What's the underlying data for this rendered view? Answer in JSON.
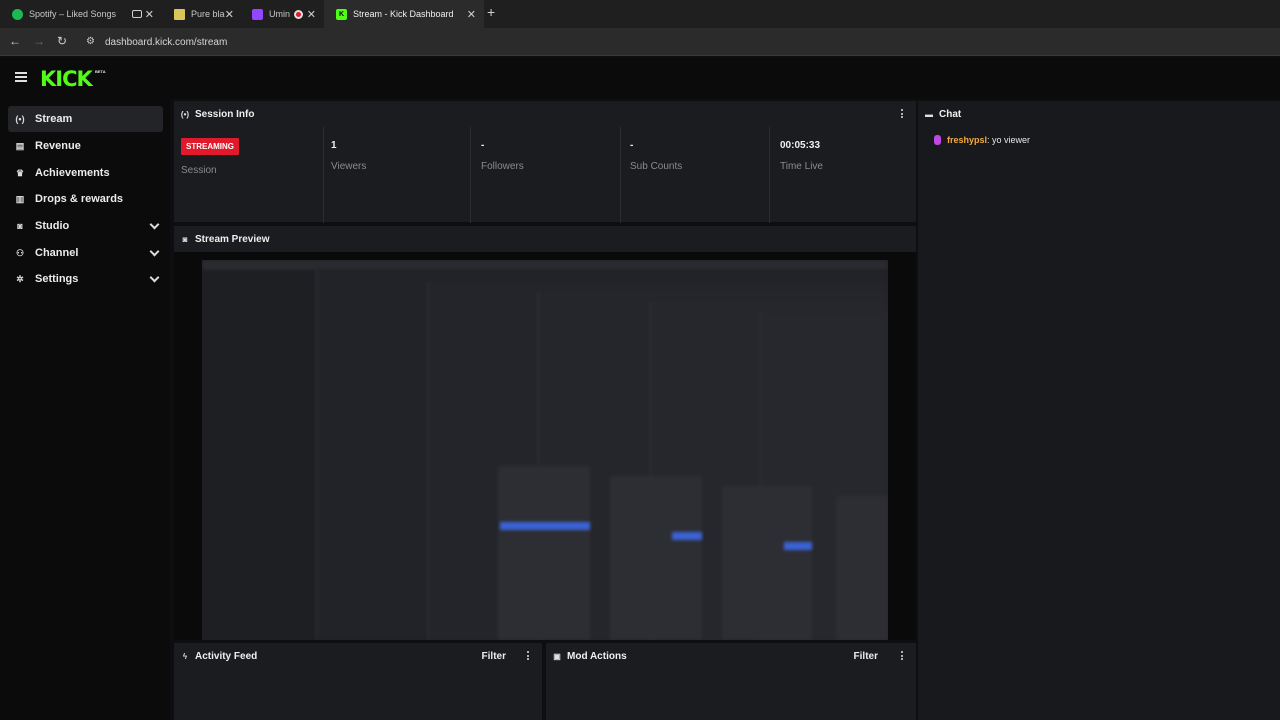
{
  "browser": {
    "tabs": [
      {
        "title": "Spotify – Liked Songs",
        "favicon": "spotify-icon",
        "color": "#1db954",
        "active": false
      },
      {
        "title": "",
        "favicon": "tab-media-icon",
        "color": "#cfcfcf",
        "active": false
      },
      {
        "title": "Pure black",
        "favicon": "pure-black-icon",
        "color": "#d8c65a",
        "active": false
      },
      {
        "title": "Umin",
        "favicon": "twitch-icon",
        "color": "#9146ff",
        "active": false
      },
      {
        "title": "Stream - Kick Dashboard",
        "favicon": "kick-icon",
        "color": "#53fc18",
        "active": true
      }
    ],
    "url": "dashboard.kick.com/stream"
  },
  "header": {
    "logo": "KICK",
    "beta": "BETA"
  },
  "sidebar": {
    "items": [
      {
        "label": "Stream",
        "icon": "broadcast-icon",
        "active": true,
        "expandable": false
      },
      {
        "label": "Revenue",
        "icon": "revenue-icon",
        "active": false,
        "expandable": false
      },
      {
        "label": "Achievements",
        "icon": "trophy-icon",
        "active": false,
        "expandable": false
      },
      {
        "label": "Drops & rewards",
        "icon": "gift-icon",
        "active": false,
        "expandable": false
      },
      {
        "label": "Studio",
        "icon": "studio-icon",
        "active": false,
        "expandable": true
      },
      {
        "label": "Channel",
        "icon": "channel-icon",
        "active": false,
        "expandable": true
      },
      {
        "label": "Settings",
        "icon": "gear-icon",
        "active": false,
        "expandable": true
      }
    ]
  },
  "session": {
    "title": "Session Info",
    "status_badge": "STREAMING",
    "status_label": "Session",
    "stats": [
      {
        "value": "1",
        "label": "Viewers"
      },
      {
        "value": "-",
        "label": "Followers"
      },
      {
        "value": "-",
        "label": "Sub Counts"
      },
      {
        "value": "00:05:33",
        "label": "Time Live"
      }
    ]
  },
  "preview": {
    "title": "Stream Preview"
  },
  "activity": {
    "title": "Activity Feed",
    "filter": "Filter"
  },
  "mod": {
    "title": "Mod Actions",
    "filter": "Filter"
  },
  "chat": {
    "title": "Chat",
    "messages": [
      {
        "user": "freshypsl",
        "text": ": yo viewer"
      }
    ]
  },
  "colors": {
    "accent": "#53fc18",
    "live": "#e0192b",
    "panel": "#1b1c1f"
  }
}
